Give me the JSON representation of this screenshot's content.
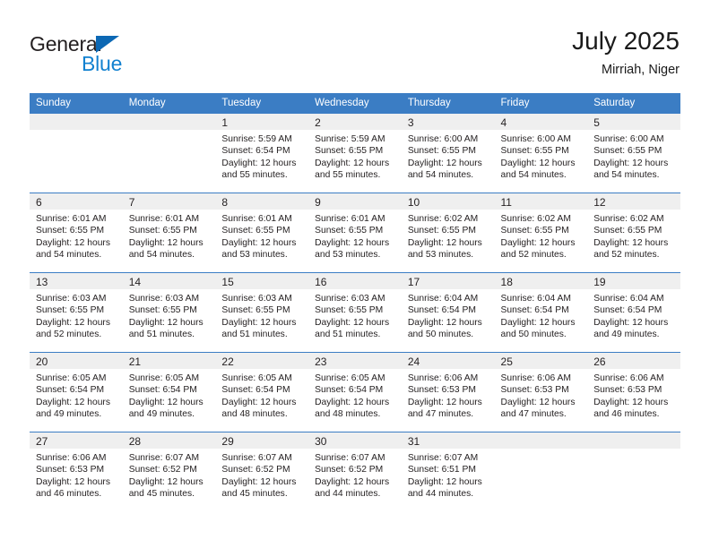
{
  "brand": {
    "name_part1": "General",
    "name_part2": "Blue",
    "accent_color": "#1281d0",
    "triangle_color": "#0c68b4"
  },
  "header": {
    "title": "July 2025",
    "subtitle": "Mirriah, Niger"
  },
  "calendar": {
    "header_color": "#3b7dc4",
    "daynum_band_color": "#efefef",
    "weekdays": [
      "Sunday",
      "Monday",
      "Tuesday",
      "Wednesday",
      "Thursday",
      "Friday",
      "Saturday"
    ],
    "weeks": [
      [
        {
          "day": "",
          "sunrise": "",
          "sunset": "",
          "daylight1": "",
          "daylight2": ""
        },
        {
          "day": "",
          "sunrise": "",
          "sunset": "",
          "daylight1": "",
          "daylight2": ""
        },
        {
          "day": "1",
          "sunrise": "Sunrise: 5:59 AM",
          "sunset": "Sunset: 6:54 PM",
          "daylight1": "Daylight: 12 hours",
          "daylight2": "and 55 minutes."
        },
        {
          "day": "2",
          "sunrise": "Sunrise: 5:59 AM",
          "sunset": "Sunset: 6:55 PM",
          "daylight1": "Daylight: 12 hours",
          "daylight2": "and 55 minutes."
        },
        {
          "day": "3",
          "sunrise": "Sunrise: 6:00 AM",
          "sunset": "Sunset: 6:55 PM",
          "daylight1": "Daylight: 12 hours",
          "daylight2": "and 54 minutes."
        },
        {
          "day": "4",
          "sunrise": "Sunrise: 6:00 AM",
          "sunset": "Sunset: 6:55 PM",
          "daylight1": "Daylight: 12 hours",
          "daylight2": "and 54 minutes."
        },
        {
          "day": "5",
          "sunrise": "Sunrise: 6:00 AM",
          "sunset": "Sunset: 6:55 PM",
          "daylight1": "Daylight: 12 hours",
          "daylight2": "and 54 minutes."
        }
      ],
      [
        {
          "day": "6",
          "sunrise": "Sunrise: 6:01 AM",
          "sunset": "Sunset: 6:55 PM",
          "daylight1": "Daylight: 12 hours",
          "daylight2": "and 54 minutes."
        },
        {
          "day": "7",
          "sunrise": "Sunrise: 6:01 AM",
          "sunset": "Sunset: 6:55 PM",
          "daylight1": "Daylight: 12 hours",
          "daylight2": "and 54 minutes."
        },
        {
          "day": "8",
          "sunrise": "Sunrise: 6:01 AM",
          "sunset": "Sunset: 6:55 PM",
          "daylight1": "Daylight: 12 hours",
          "daylight2": "and 53 minutes."
        },
        {
          "day": "9",
          "sunrise": "Sunrise: 6:01 AM",
          "sunset": "Sunset: 6:55 PM",
          "daylight1": "Daylight: 12 hours",
          "daylight2": "and 53 minutes."
        },
        {
          "day": "10",
          "sunrise": "Sunrise: 6:02 AM",
          "sunset": "Sunset: 6:55 PM",
          "daylight1": "Daylight: 12 hours",
          "daylight2": "and 53 minutes."
        },
        {
          "day": "11",
          "sunrise": "Sunrise: 6:02 AM",
          "sunset": "Sunset: 6:55 PM",
          "daylight1": "Daylight: 12 hours",
          "daylight2": "and 52 minutes."
        },
        {
          "day": "12",
          "sunrise": "Sunrise: 6:02 AM",
          "sunset": "Sunset: 6:55 PM",
          "daylight1": "Daylight: 12 hours",
          "daylight2": "and 52 minutes."
        }
      ],
      [
        {
          "day": "13",
          "sunrise": "Sunrise: 6:03 AM",
          "sunset": "Sunset: 6:55 PM",
          "daylight1": "Daylight: 12 hours",
          "daylight2": "and 52 minutes."
        },
        {
          "day": "14",
          "sunrise": "Sunrise: 6:03 AM",
          "sunset": "Sunset: 6:55 PM",
          "daylight1": "Daylight: 12 hours",
          "daylight2": "and 51 minutes."
        },
        {
          "day": "15",
          "sunrise": "Sunrise: 6:03 AM",
          "sunset": "Sunset: 6:55 PM",
          "daylight1": "Daylight: 12 hours",
          "daylight2": "and 51 minutes."
        },
        {
          "day": "16",
          "sunrise": "Sunrise: 6:03 AM",
          "sunset": "Sunset: 6:55 PM",
          "daylight1": "Daylight: 12 hours",
          "daylight2": "and 51 minutes."
        },
        {
          "day": "17",
          "sunrise": "Sunrise: 6:04 AM",
          "sunset": "Sunset: 6:54 PM",
          "daylight1": "Daylight: 12 hours",
          "daylight2": "and 50 minutes."
        },
        {
          "day": "18",
          "sunrise": "Sunrise: 6:04 AM",
          "sunset": "Sunset: 6:54 PM",
          "daylight1": "Daylight: 12 hours",
          "daylight2": "and 50 minutes."
        },
        {
          "day": "19",
          "sunrise": "Sunrise: 6:04 AM",
          "sunset": "Sunset: 6:54 PM",
          "daylight1": "Daylight: 12 hours",
          "daylight2": "and 49 minutes."
        }
      ],
      [
        {
          "day": "20",
          "sunrise": "Sunrise: 6:05 AM",
          "sunset": "Sunset: 6:54 PM",
          "daylight1": "Daylight: 12 hours",
          "daylight2": "and 49 minutes."
        },
        {
          "day": "21",
          "sunrise": "Sunrise: 6:05 AM",
          "sunset": "Sunset: 6:54 PM",
          "daylight1": "Daylight: 12 hours",
          "daylight2": "and 49 minutes."
        },
        {
          "day": "22",
          "sunrise": "Sunrise: 6:05 AM",
          "sunset": "Sunset: 6:54 PM",
          "daylight1": "Daylight: 12 hours",
          "daylight2": "and 48 minutes."
        },
        {
          "day": "23",
          "sunrise": "Sunrise: 6:05 AM",
          "sunset": "Sunset: 6:54 PM",
          "daylight1": "Daylight: 12 hours",
          "daylight2": "and 48 minutes."
        },
        {
          "day": "24",
          "sunrise": "Sunrise: 6:06 AM",
          "sunset": "Sunset: 6:53 PM",
          "daylight1": "Daylight: 12 hours",
          "daylight2": "and 47 minutes."
        },
        {
          "day": "25",
          "sunrise": "Sunrise: 6:06 AM",
          "sunset": "Sunset: 6:53 PM",
          "daylight1": "Daylight: 12 hours",
          "daylight2": "and 47 minutes."
        },
        {
          "day": "26",
          "sunrise": "Sunrise: 6:06 AM",
          "sunset": "Sunset: 6:53 PM",
          "daylight1": "Daylight: 12 hours",
          "daylight2": "and 46 minutes."
        }
      ],
      [
        {
          "day": "27",
          "sunrise": "Sunrise: 6:06 AM",
          "sunset": "Sunset: 6:53 PM",
          "daylight1": "Daylight: 12 hours",
          "daylight2": "and 46 minutes."
        },
        {
          "day": "28",
          "sunrise": "Sunrise: 6:07 AM",
          "sunset": "Sunset: 6:52 PM",
          "daylight1": "Daylight: 12 hours",
          "daylight2": "and 45 minutes."
        },
        {
          "day": "29",
          "sunrise": "Sunrise: 6:07 AM",
          "sunset": "Sunset: 6:52 PM",
          "daylight1": "Daylight: 12 hours",
          "daylight2": "and 45 minutes."
        },
        {
          "day": "30",
          "sunrise": "Sunrise: 6:07 AM",
          "sunset": "Sunset: 6:52 PM",
          "daylight1": "Daylight: 12 hours",
          "daylight2": "and 44 minutes."
        },
        {
          "day": "31",
          "sunrise": "Sunrise: 6:07 AM",
          "sunset": "Sunset: 6:51 PM",
          "daylight1": "Daylight: 12 hours",
          "daylight2": "and 44 minutes."
        },
        {
          "day": "",
          "sunrise": "",
          "sunset": "",
          "daylight1": "",
          "daylight2": ""
        },
        {
          "day": "",
          "sunrise": "",
          "sunset": "",
          "daylight1": "",
          "daylight2": ""
        }
      ]
    ]
  }
}
